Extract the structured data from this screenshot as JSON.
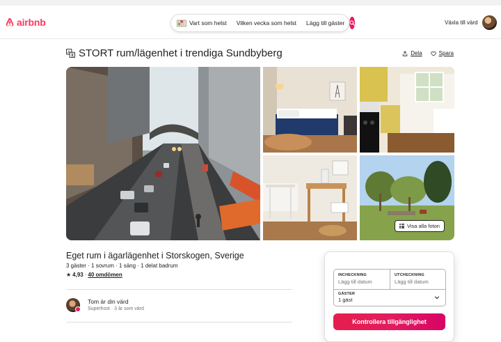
{
  "header": {
    "logo_text": "airbnb",
    "search": {
      "where": "Vart som helst",
      "when": "Vilken vecka som helst",
      "who": "Lägg till gäster"
    },
    "host_switch": "Växla till värd"
  },
  "listing": {
    "title": "STORT rum/lägenhet i trendiga Sundbyberg",
    "share": "Dela",
    "save": "Spara",
    "show_all_photos": "Visa alla foton",
    "subtitle": "Eget rum i ägarlägenhet i Storskogen, Sverige",
    "facts": "3 gäster · 1 sovrum · 1 säng · 1 delat badrum",
    "rating": "4,93",
    "rating_sep": "·",
    "reviews": "40 omdömen",
    "host_name": "Tom är din värd",
    "host_meta": "Superhost · 3 år som värd"
  },
  "booking": {
    "checkin_label": "INCHECKNING",
    "checkin_value": "Lägg till datum",
    "checkout_label": "UTCHECKNING",
    "checkout_value": "Lägg till datum",
    "guests_label": "GÄSTER",
    "guests_value": "1 gäst",
    "button": "Kontrollera tillgänglighet"
  },
  "colors": {
    "brand": "#ff385c",
    "search_button": "#e31c5f",
    "cta": "#e31c5f"
  }
}
